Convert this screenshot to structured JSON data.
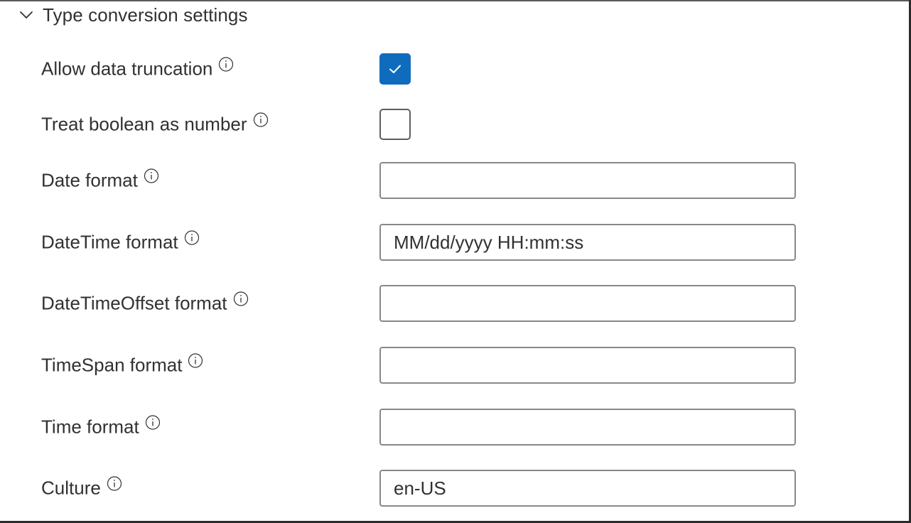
{
  "section": {
    "title": "Type conversion settings",
    "expanded": true,
    "chevron_icon": "chevron-down-icon"
  },
  "fields": {
    "allow_data_truncation": {
      "label": "Allow data truncation",
      "checked": true
    },
    "treat_boolean_as_number": {
      "label": "Treat boolean as number",
      "checked": false
    },
    "date_format": {
      "label": "Date format",
      "value": ""
    },
    "datetime_format": {
      "label": "DateTime format",
      "value": "MM/dd/yyyy HH:mm:ss"
    },
    "datetimeoffset_format": {
      "label": "DateTimeOffset format",
      "value": ""
    },
    "timespan_format": {
      "label": "TimeSpan format",
      "value": ""
    },
    "time_format": {
      "label": "Time format",
      "value": ""
    },
    "culture": {
      "label": "Culture",
      "value": "en-US"
    }
  },
  "colors": {
    "accent": "#0f6cbd",
    "text": "#323130",
    "border": "#8a8886"
  },
  "icons": {
    "info": "info-icon",
    "check": "checkmark-icon"
  }
}
